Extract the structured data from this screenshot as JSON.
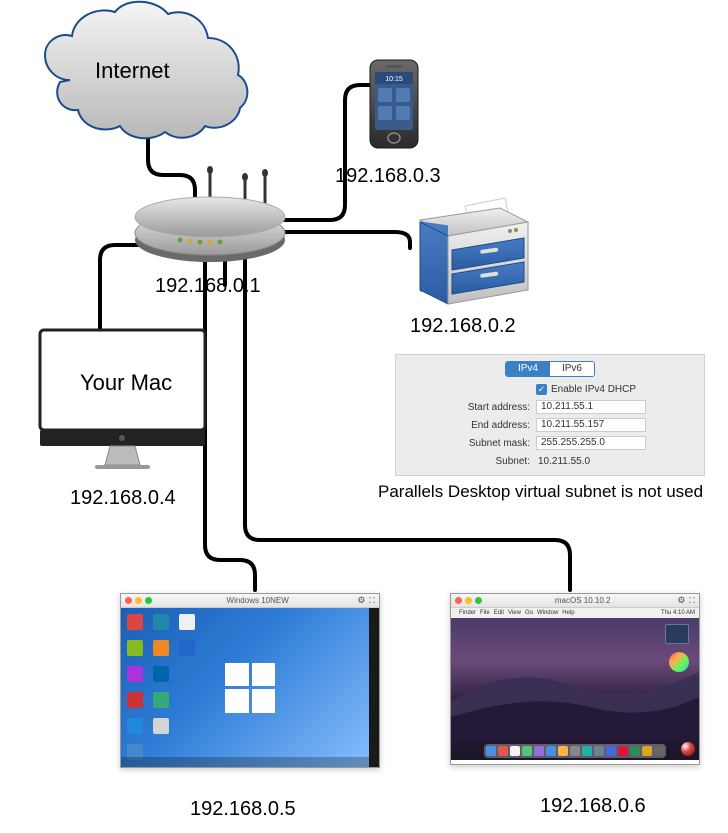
{
  "cloud_label": "Internet",
  "devices": {
    "phone_ip": "192.168.0.3",
    "router_ip": "192.168.0.1",
    "printer_ip": "192.168.0.2",
    "mac_label": "Your Mac",
    "mac_ip": "192.168.0.4",
    "vm_win_ip": "192.168.0.5",
    "vm_mac_ip": "192.168.0.6"
  },
  "config_panel": {
    "tabs": {
      "ipv4": "IPv4",
      "ipv6": "IPv6"
    },
    "enable_dhcp_label": "Enable IPv4 DHCP",
    "rows": {
      "start_address": {
        "label": "Start address:",
        "value": "10.211.55.1"
      },
      "end_address": {
        "label": "End address:",
        "value": "10.211.55.157"
      },
      "subnet_mask": {
        "label": "Subnet mask:",
        "value": "255.255.255.0"
      },
      "subnet": {
        "label": "Subnet:",
        "value": "10.211.55.0"
      }
    },
    "caption": "Parallels Desktop virtual subnet is not used"
  },
  "vm_win": {
    "title": "Windows 10NEW"
  },
  "vm_mac": {
    "title": "macOS 10.10.2",
    "menu_items": [
      "Finder",
      "File",
      "Edit",
      "View",
      "Go",
      "Window",
      "Help"
    ],
    "clock": "Thu 4:10 AM"
  }
}
